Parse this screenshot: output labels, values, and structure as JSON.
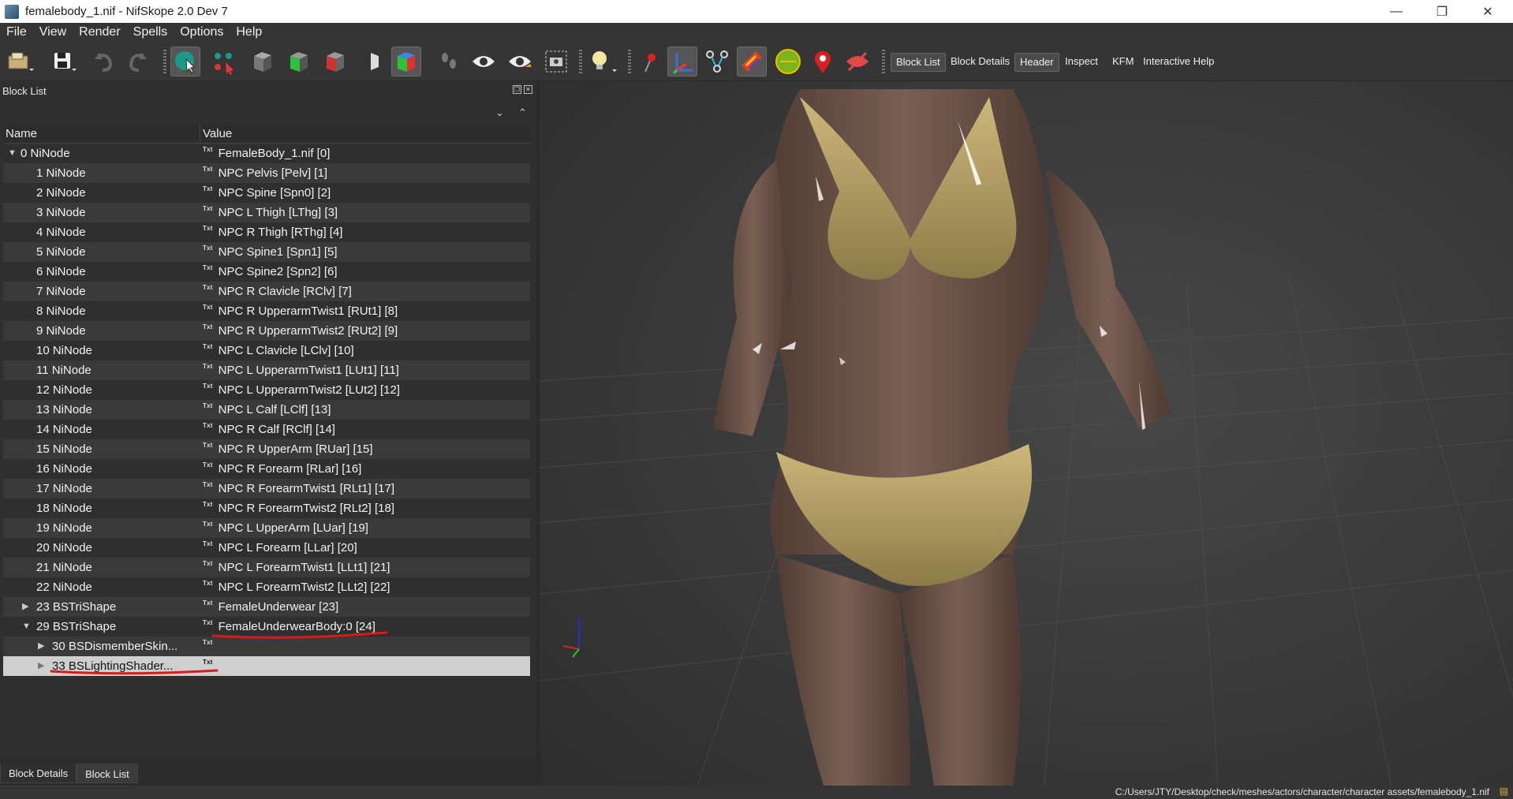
{
  "window": {
    "title": "femalebody_1.nif - NifSkope 2.0 Dev 7",
    "controls": {
      "minimize": "—",
      "maximize": "❐",
      "close": "✕"
    }
  },
  "menu": [
    "File",
    "View",
    "Render",
    "Spells",
    "Options",
    "Help"
  ],
  "toolbar": {
    "icons": [
      "load-icon",
      "save-icon",
      "undo-icon",
      "redo-icon",
      "select-object-icon",
      "select-vertex-icon",
      "view-top-icon",
      "view-front-icon",
      "view-side-icon",
      "view-user-icon",
      "view-walk-icon",
      "footsteps-icon",
      "eye-icon",
      "eye-alt-icon",
      "screenshot-icon",
      "lightbulb-icon",
      "pin-icon",
      "axes-icon",
      "nodes-icon",
      "textures-icon",
      "collision-icon",
      "marker-icon",
      "hidden-icon"
    ],
    "panel_buttons": [
      "Block List",
      "Block Details",
      "Header",
      "Inspect",
      "KFM",
      "Interactive Help"
    ]
  },
  "block_list": {
    "title": "Block List",
    "columns": {
      "name": "Name",
      "value": "Value"
    },
    "txt_tag": "Txt",
    "rows": [
      {
        "name": "0 NiNode",
        "value": "FemaleBody_1.nif [0]",
        "depth": 0,
        "arrow": "expanded"
      },
      {
        "name": "1 NiNode",
        "value": "NPC Pelvis [Pelv] [1]",
        "depth": 1
      },
      {
        "name": "2 NiNode",
        "value": "NPC Spine [Spn0] [2]",
        "depth": 1
      },
      {
        "name": "3 NiNode",
        "value": "NPC L Thigh [LThg] [3]",
        "depth": 1
      },
      {
        "name": "4 NiNode",
        "value": "NPC R Thigh [RThg] [4]",
        "depth": 1
      },
      {
        "name": "5 NiNode",
        "value": "NPC Spine1 [Spn1] [5]",
        "depth": 1
      },
      {
        "name": "6 NiNode",
        "value": "NPC Spine2 [Spn2] [6]",
        "depth": 1
      },
      {
        "name": "7 NiNode",
        "value": "NPC R Clavicle [RClv] [7]",
        "depth": 1
      },
      {
        "name": "8 NiNode",
        "value": "NPC R UpperarmTwist1 [RUt1] [8]",
        "depth": 1
      },
      {
        "name": "9 NiNode",
        "value": "NPC R UpperarmTwist2 [RUt2] [9]",
        "depth": 1
      },
      {
        "name": "10 NiNode",
        "value": "NPC L Clavicle [LClv] [10]",
        "depth": 1
      },
      {
        "name": "11 NiNode",
        "value": "NPC L UpperarmTwist1 [LUt1] [11]",
        "depth": 1
      },
      {
        "name": "12 NiNode",
        "value": "NPC L UpperarmTwist2 [LUt2] [12]",
        "depth": 1
      },
      {
        "name": "13 NiNode",
        "value": "NPC L Calf [LClf] [13]",
        "depth": 1
      },
      {
        "name": "14 NiNode",
        "value": "NPC R Calf [RClf] [14]",
        "depth": 1
      },
      {
        "name": "15 NiNode",
        "value": "NPC R UpperArm [RUar] [15]",
        "depth": 1
      },
      {
        "name": "16 NiNode",
        "value": "NPC R Forearm [RLar] [16]",
        "depth": 1
      },
      {
        "name": "17 NiNode",
        "value": "NPC R ForearmTwist1 [RLt1] [17]",
        "depth": 1
      },
      {
        "name": "18 NiNode",
        "value": "NPC R ForearmTwist2 [RLt2] [18]",
        "depth": 1
      },
      {
        "name": "19 NiNode",
        "value": "NPC L UpperArm [LUar] [19]",
        "depth": 1
      },
      {
        "name": "20 NiNode",
        "value": "NPC L Forearm [LLar] [20]",
        "depth": 1
      },
      {
        "name": "21 NiNode",
        "value": "NPC L ForearmTwist1 [LLt1] [21]",
        "depth": 1
      },
      {
        "name": "22 NiNode",
        "value": "NPC L ForearmTwist2 [LLt2] [22]",
        "depth": 1
      },
      {
        "name": "23 BSTriShape",
        "value": "FemaleUnderwear [23]",
        "depth": 1,
        "arrow": "collapsed"
      },
      {
        "name": "29 BSTriShape",
        "value": "FemaleUnderwearBody:0 [24]",
        "depth": 1,
        "arrow": "expanded",
        "underline_value": true
      },
      {
        "name": "30 BSDismemberSkin...",
        "value": "",
        "depth": 2,
        "arrow": "collapsed"
      },
      {
        "name": "33 BSLightingShader...",
        "value": "",
        "depth": 2,
        "arrow": "collapsed",
        "selected": true,
        "underline_name": true
      }
    ]
  },
  "bottom_tabs": [
    "Block Details",
    "Block List"
  ],
  "status": {
    "path": "C:/Users/JTY/Desktop/check/meshes/actors/character/character assets/femalebody_1.nif"
  },
  "colors": {
    "skin": "#6e554a",
    "underwear": "#b9a46a",
    "annotation": "#d91a1a",
    "viewport_bg": "#3a3a3a"
  }
}
